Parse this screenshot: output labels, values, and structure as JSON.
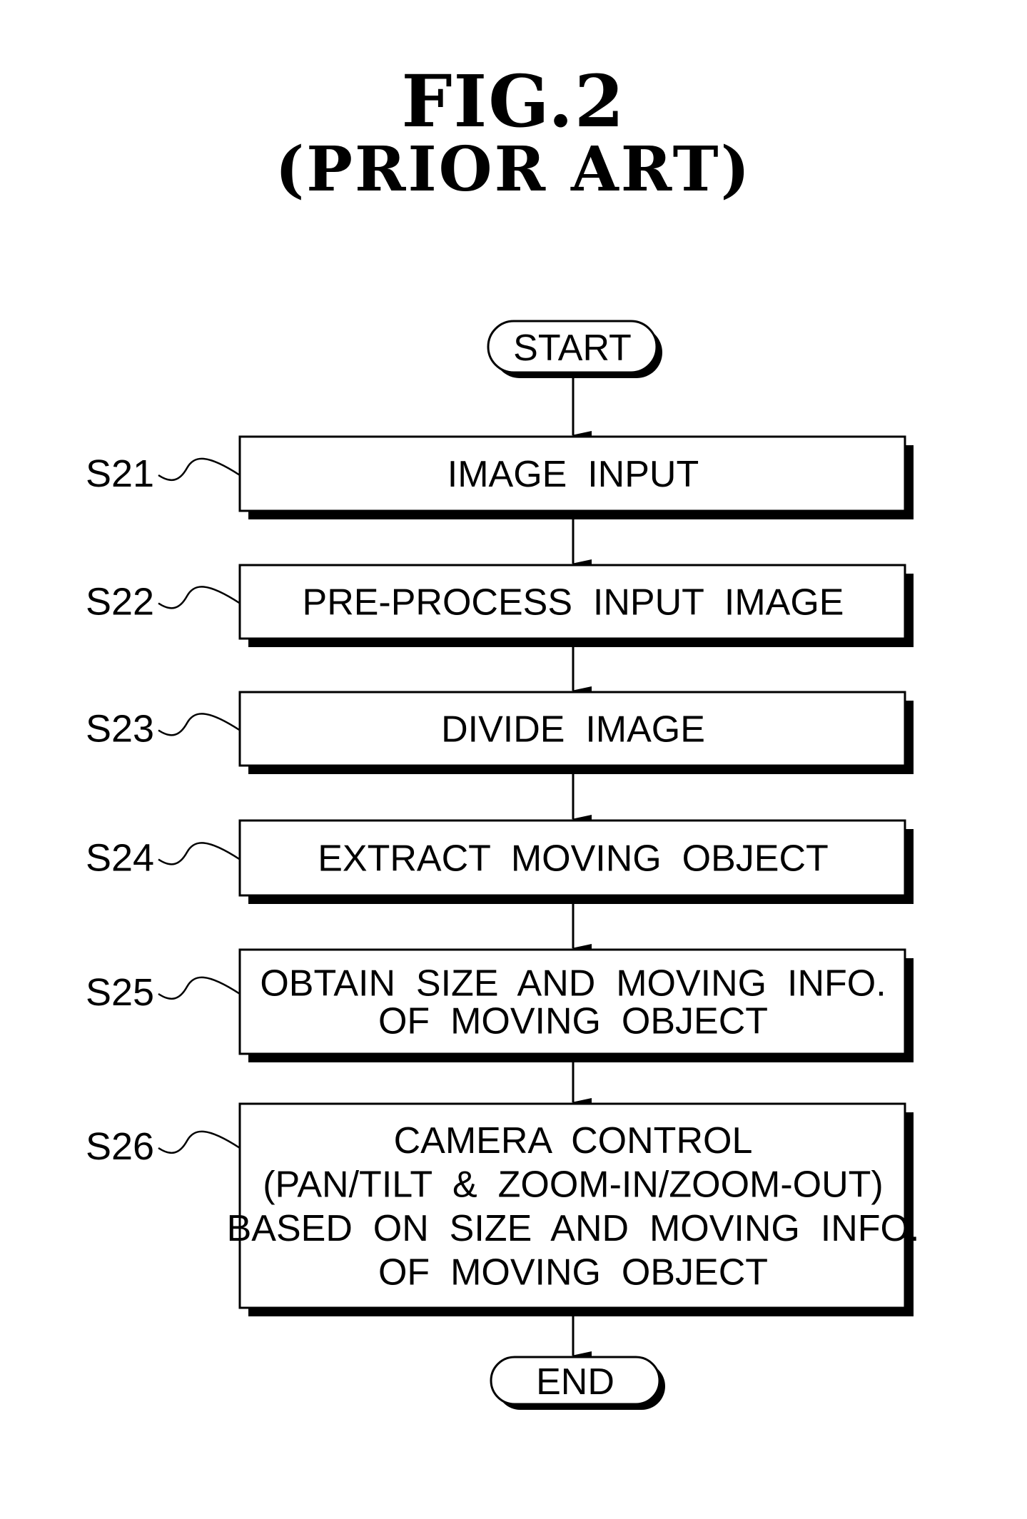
{
  "figure": {
    "title": "FIG.2",
    "subtitle": "(PRIOR ART)"
  },
  "flowchart": {
    "start_label": "START",
    "end_label": "END",
    "steps": [
      {
        "id": "S21",
        "lines": [
          "IMAGE  INPUT"
        ]
      },
      {
        "id": "S22",
        "lines": [
          "PRE-PROCESS  INPUT  IMAGE"
        ]
      },
      {
        "id": "S23",
        "lines": [
          "DIVIDE  IMAGE"
        ]
      },
      {
        "id": "S24",
        "lines": [
          "EXTRACT  MOVING  OBJECT"
        ]
      },
      {
        "id": "S25",
        "lines": [
          "OBTAIN  SIZE  AND  MOVING  INFO.",
          "OF  MOVING  OBJECT"
        ]
      },
      {
        "id": "S26",
        "lines": [
          "CAMERA  CONTROL",
          "(PAN/TILT  &  ZOOM-IN/ZOOM-OUT)",
          "BASED  ON  SIZE  AND  MOVING  INFO.",
          "OF  MOVING  OBJECT"
        ]
      }
    ]
  },
  "colors": {
    "ink": "#000000",
    "paper": "#ffffff"
  }
}
